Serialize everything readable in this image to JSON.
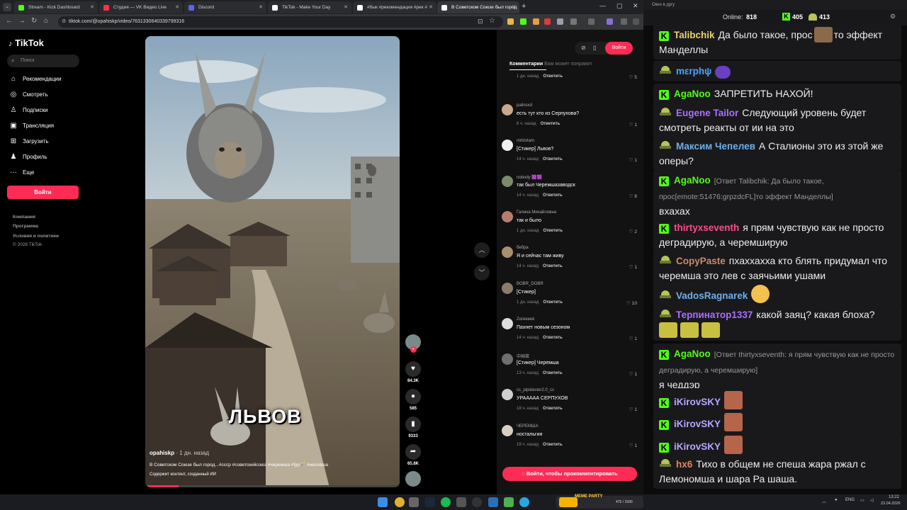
{
  "browser": {
    "tabs": [
      {
        "label": "Stream - Kick Dashboard",
        "color": "#53fc18"
      },
      {
        "label": "Студия — VK Видео Live",
        "color": "#ff3347"
      },
      {
        "label": "Discord",
        "color": "#5865f2"
      },
      {
        "label": "TikTok - Make Your Day",
        "color": "#ffffff"
      },
      {
        "label": "#бык #рекомендации #рек #",
        "color": "#ffffff"
      },
      {
        "label": "В Советском Союзе был город",
        "color": "#ffffff"
      }
    ],
    "url": "tiktok.com/@opahiskp/video/7631330640339799316"
  },
  "tiktok": {
    "logo": "TikTok",
    "search_placeholder": "Поиск",
    "menu": [
      {
        "label": "Рекомендации",
        "icon": "home-icon",
        "glyph": "⌂"
      },
      {
        "label": "Смотреть",
        "icon": "compass-icon",
        "glyph": "◎"
      },
      {
        "label": "Подписки",
        "icon": "user-icon",
        "glyph": "♙"
      },
      {
        "label": "Трансляция",
        "icon": "live-icon",
        "glyph": "▣"
      },
      {
        "label": "Загрузить",
        "icon": "upload-icon",
        "glyph": "⊞"
      },
      {
        "label": "Профиль",
        "icon": "profile-icon",
        "glyph": "♟"
      },
      {
        "label": "Еще",
        "icon": "more-icon",
        "glyph": "···"
      }
    ],
    "login": "Войти",
    "footer": [
      "Компания",
      "Программа",
      "Условия и политики",
      "© 2026 TikTok"
    ],
    "video": {
      "caption": "ЛЬВОВ",
      "author": "opahiskp",
      "time": "· 1 дн. назад",
      "description": "В Советском Союзе был город...#ссср #советскийсоюз #черемша #fyp🪄 #неспеша",
      "ai_label": "Содержит контент, созданный ИИ",
      "progress": 0.13
    },
    "actions": [
      {
        "icon": "heart-icon",
        "glyph": "♥",
        "count": "84.3K"
      },
      {
        "icon": "comment-icon",
        "glyph": "●",
        "count": "585"
      },
      {
        "icon": "bookmark-icon",
        "glyph": "▮",
        "count": "9333"
      },
      {
        "icon": "share-icon",
        "glyph": "➦",
        "count": "65.8K"
      }
    ],
    "comments_panel": {
      "tab_active": "Комментарии",
      "tab_other": "Вам может понравит",
      "login_top": "Войти",
      "first_meta": {
        "time": "1 дн. назад",
        "reply": "Ответить",
        "likes": "5"
      },
      "comments": [
        {
          "name": "palinsxd",
          "text": "есть тут кто из Серпухова?",
          "time": "6 ч. назад",
          "reply": "Ответить",
          "likes": "1",
          "color": "#c9a98a"
        },
        {
          "name": "mrktotam",
          "text": "[Стикер] Львов?",
          "time": "14 ч. назад",
          "reply": "Ответить",
          "likes": "1",
          "color": "#f0f0f0"
        },
        {
          "name": "nobody 🟪🟪",
          "text": "так был Черемшазаводск",
          "time": "14 ч. назад",
          "reply": "Ответить",
          "likes": "8",
          "color": "#7c8a6a"
        },
        {
          "name": "Галина Михайловна",
          "text": "так и было",
          "time": "1 дн. назад",
          "reply": "Ответить",
          "likes": "2",
          "color": "#b67d6d"
        },
        {
          "name": "бебра",
          "text": "Я и сейчас там живу",
          "time": "14 ч. назад",
          "reply": "Ответить",
          "likes": "1",
          "color": "#a98f6e"
        },
        {
          "name": "BOBR_DOBR",
          "text": "[Стикер]",
          "time": "1 дн. назад",
          "reply": "Ответить",
          "likes": "10",
          "color": "#8c7b6b"
        },
        {
          "name": "Zoreeeek",
          "text": "Пахнет новым сезоном",
          "time": "14 ч. назад",
          "reply": "Ответить",
          "likes": "1",
          "color": "#dddddd"
        },
        {
          "name": "中国菜",
          "text": "[Стикер] Черемша",
          "time": "13 ч. назад",
          "reply": "Ответить",
          "likes": "1",
          "color": "#6f6f6f"
        },
        {
          "name": "cs_pipidaster2.0_cs",
          "text": "УРААААА СЕРПУХОВ",
          "time": "18 ч. назад",
          "reply": "Ответить",
          "likes": "1",
          "color": "#cfcfcf"
        },
        {
          "name": "ЧЕРЕМША",
          "text": "ностальгия",
          "time": "19 ч. назад",
          "reply": "Ответить",
          "likes": "1",
          "color": "#d8cfc0"
        }
      ],
      "login_comment": "Войти, чтобы прокомментировать"
    }
  },
  "chat": {
    "window_title": "Окно в дугу",
    "online_label": "Online:",
    "online_count": "818",
    "kick_count": "405",
    "other_count": "413",
    "messages": [
      {
        "badge": "kick",
        "user": "Talibchik",
        "color": "#e8d36b",
        "text": "Да было такое, прос",
        "text2": "то эффект Манделлы"
      },
      {
        "badge": "hat",
        "user": "mεrphψ",
        "color": "#4aa3ff",
        "text": ""
      },
      {
        "badge": "kick",
        "user": "AgaNoo",
        "color": "#53fc18",
        "text": "ЗАПРЕТИТЬ НАХОЙ!"
      },
      {
        "badge": "hat",
        "user": "Eugene Tailor",
        "color": "#a970ff",
        "text": "Следующий уровень будет смотреть реакты от ии на это"
      },
      {
        "badge": "hat",
        "user": "Максим Чепелев",
        "color": "#6fb0e8",
        "text": "А Сталионы это из этой же оперы?"
      },
      {
        "badge": "kick",
        "user": "AgaNoo",
        "color": "#53fc18",
        "reply": "[Ответ Talibchik: Да было такое, прос[emote:51476:grpzdcFL]то эффект Манделлы]",
        "text": "вхахах"
      },
      {
        "badge": "kick",
        "user": "thirtyxseventh",
        "color": "#ff4b8b",
        "text": "я прям чувствую как не просто деградирую, а черемширую"
      },
      {
        "badge": "hat",
        "user": "CopyPaste",
        "color": "#c98b6b",
        "text": "пхаххахха кто блять придумал что черемша это лев с заячьими ушами"
      },
      {
        "badge": "hat",
        "user": "VadosRagnarek",
        "color": "#6fb0e8",
        "text": ""
      },
      {
        "badge": "hat",
        "user": "Терпинатор1337",
        "color": "#a970ff",
        "text": "какой заяц? какая блоха?"
      },
      {
        "badge": "kick",
        "user": "AgaNoo",
        "color": "#53fc18",
        "reply": "[Ответ thirtyxseventh: я прям чувствую как не просто деградирую, а черемширую]",
        "text": "я чеддэр"
      },
      {
        "badge": "kick",
        "user": "iKirovSKY",
        "color": "#b9a6ff",
        "text": ""
      },
      {
        "badge": "kick",
        "user": "iKirovSKY",
        "color": "#b9a6ff",
        "text": ""
      },
      {
        "badge": "kick",
        "user": "iKirovSKY",
        "color": "#b9a6ff",
        "text": ""
      },
      {
        "badge": "hat",
        "user": "hx6",
        "color": "#e4855a",
        "text": "Тихо в общем не спеша жара ржал с Лемономша и шара Ра шаша."
      }
    ]
  },
  "taskbar": {
    "lang": "ENG",
    "time": "13:22",
    "date": "23.04.2026",
    "media": "MEME PARTY",
    "media_counter": "475 / 1590"
  }
}
